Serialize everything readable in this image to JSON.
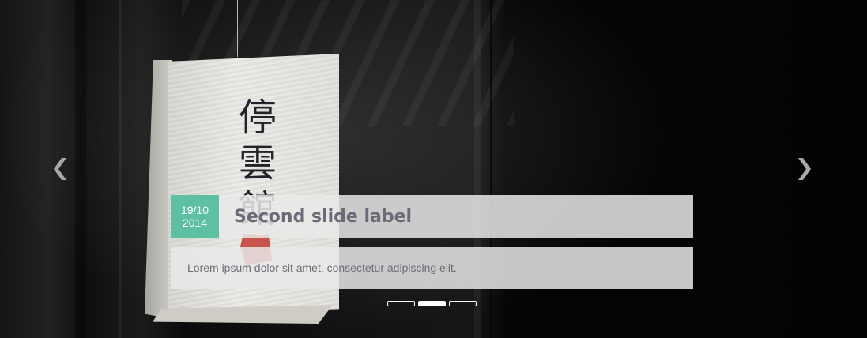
{
  "slide": {
    "date_line1": "19/10",
    "date_line2": "2014",
    "title": "Second slide label",
    "text": "Lorem ipsum dolor sit amet, consectetur adipiscing elit.",
    "image_text": "停雲館"
  },
  "controls": {
    "prev_icon": "chevron-left-icon",
    "next_icon": "chevron-right-icon"
  },
  "indicators": [
    {
      "active": false
    },
    {
      "active": true
    },
    {
      "active": false
    }
  ],
  "colors": {
    "date_badge": "#5dc0a2",
    "caption_bg": "#e9e9e9",
    "title_text": "#6b6b78",
    "body_text": "#6d6d78",
    "indicator": "#ffffff"
  }
}
